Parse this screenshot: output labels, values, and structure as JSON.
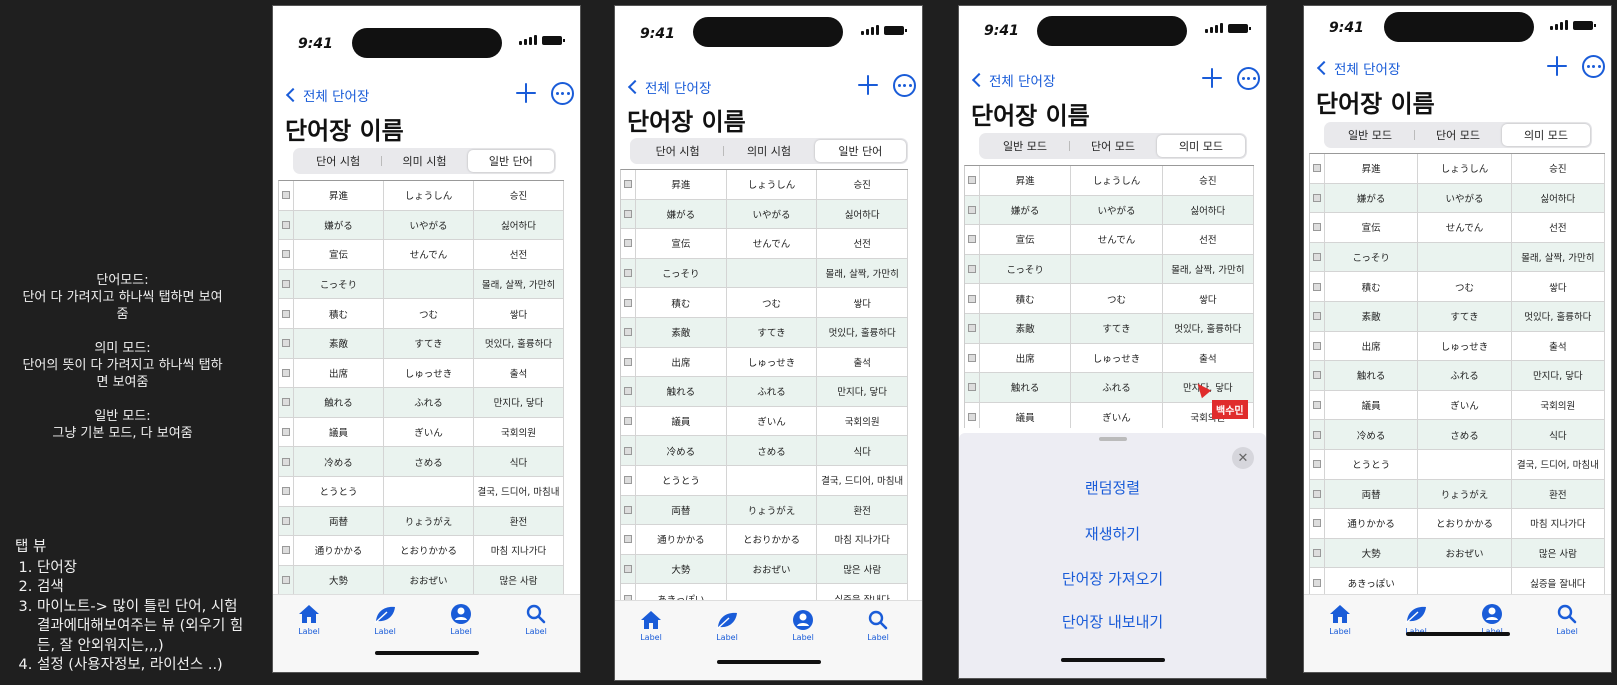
{
  "notes": [
    "단어모드:\n단어 다 가려지고 하나씩 탭하면 보여줌",
    "의미 모드:\n단어의 뜻이 다 가려지고 하나씩 탭하면 보여줌",
    "일반 모드:\n그냥 기본 모드, 다 보여줌"
  ],
  "tabview": {
    "title": "탭 뷰",
    "items": [
      "단어장",
      "검색",
      "마이노트-> 많이 틀린 단어, 시험결과에대해보여주는 뷰 (외우기 힘든, 잘 안외워지는,,,)",
      "설정 (사용자정보, 라이선스 ..)"
    ]
  },
  "status_time": "9:41",
  "nav": {
    "back_label": "전체 단어장"
  },
  "title": "단어장 이름",
  "screens": [
    {
      "segments": [
        "단어 시험",
        "의미 시험",
        "일반 단어"
      ],
      "active": 2
    },
    {
      "segments": [
        "단어 시험",
        "의미 시험",
        "일반 단어"
      ],
      "active": 2
    },
    {
      "segments": [
        "일반 모드",
        "단어 모드",
        "의미 모드"
      ],
      "active": 2
    },
    {
      "segments": [
        "일반 모드",
        "단어 모드",
        "의미 모드"
      ],
      "active": 2
    }
  ],
  "table_rows": [
    [
      "昇進",
      "しょうしん",
      "승진"
    ],
    [
      "嫌がる",
      "いやがる",
      "싫어하다"
    ],
    [
      "宣伝",
      "せんでん",
      "선전"
    ],
    [
      "こっそり",
      "",
      "몰래, 살짝, 가만히"
    ],
    [
      "積む",
      "つむ",
      "쌓다"
    ],
    [
      "素敵",
      "すてき",
      "멋있다, 훌륭하다"
    ],
    [
      "出席",
      "しゅっせき",
      "출석"
    ],
    [
      "触れる",
      "ふれる",
      "만지다, 닿다"
    ],
    [
      "議員",
      "ぎいん",
      "국회의원"
    ],
    [
      "冷める",
      "さめる",
      "식다"
    ],
    [
      "とうとう",
      "",
      "결국, 드디어, 마침내"
    ],
    [
      "両替",
      "りょうがえ",
      "환전"
    ],
    [
      "通りかかる",
      "とおりかかる",
      "마침 지나가다"
    ],
    [
      "大勢",
      "おおぜい",
      "많은 사람"
    ],
    [
      "あきっぽい",
      "",
      "싫증을 잘내다"
    ]
  ],
  "tabbar": {
    "labels": [
      "Label",
      "Label",
      "Label",
      "Label"
    ]
  },
  "sheet": {
    "items": [
      "랜덤정렬",
      "재생하기",
      "단어장 가져오기",
      "단어장 내보내기"
    ],
    "close_glyph": "✕"
  },
  "cursor_label": "백수민",
  "colors": {
    "accent": "#1a5cd8",
    "row_alt": "#eaf3ef",
    "cursor": "#e02c2c"
  }
}
